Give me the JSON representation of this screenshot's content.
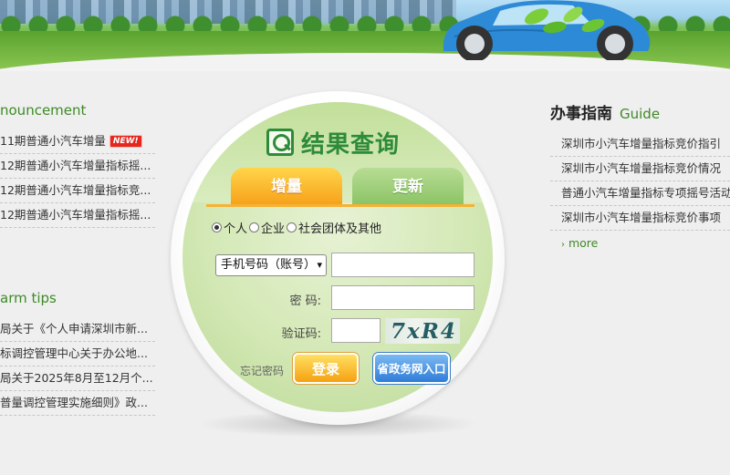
{
  "left_panel": {
    "announcement": {
      "title": "nouncement",
      "items": [
        {
          "text": "11期普通小汽车增量",
          "badge": "NEW!"
        },
        {
          "text": "12期普通小汽车增量指标摇..."
        },
        {
          "text": "12期普通小汽车增量指标竞..."
        },
        {
          "text": "12期普通小汽车增量指标摇..."
        }
      ]
    },
    "warm_tips": {
      "title": "arm tips",
      "items": [
        {
          "text": "局关于《个人申请深圳市新..."
        },
        {
          "text": "标调控管理中心关于办公地..."
        },
        {
          "text": "局关于2025年8月至12月个..."
        },
        {
          "text": "普量调控管理实施细则》政..."
        }
      ]
    }
  },
  "right_panel": {
    "title_cn": "办事指南",
    "title_en": "Guide",
    "items": [
      {
        "text": "深圳市小汽车增量指标竞价指引"
      },
      {
        "text": "深圳市小汽车增量指标竞价情况"
      },
      {
        "text": "普通小汽车增量指标专项摇号活动"
      },
      {
        "text": "深圳市小汽车增量指标竞价事项"
      }
    ],
    "more": "more"
  },
  "query": {
    "title": "结果查询",
    "tabs": [
      {
        "label": "增量",
        "active": true
      },
      {
        "label": "更新",
        "active": false
      }
    ],
    "applicant_types": [
      {
        "label": "个人",
        "selected": true
      },
      {
        "label": "企业",
        "selected": false
      },
      {
        "label": "社会团体及其他",
        "selected": false
      }
    ],
    "account_type": {
      "selected": "手机号码（账号）"
    },
    "account_value": "",
    "password_label": "密 码:",
    "password_value": "",
    "captcha_label": "验证码:",
    "captcha_value": "",
    "captcha_text": "7xR4",
    "forgot_label": "忘记密码",
    "login_button": "登录",
    "gov_button": "省政务网入口"
  },
  "colors": {
    "accent_green": "#3e8a26",
    "tab_active": "#f7a21b",
    "tab_inactive": "#8cc466",
    "login_button": "#f5a10f",
    "gov_button": "#2f7dd8",
    "new_badge": "#e4271f"
  }
}
